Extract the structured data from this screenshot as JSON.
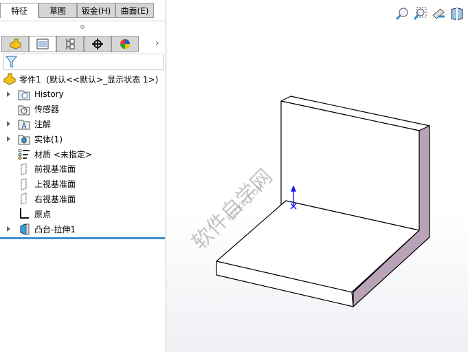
{
  "cmd_tabs": [
    "特征",
    "草图",
    "钣金(H)",
    "曲面(E)"
  ],
  "manager_tabs": [
    "featuremanager",
    "propertymanager",
    "configurationmanager",
    "dimxpert",
    "displaymanager"
  ],
  "root": "零件1  (默认<<默认>_显示状态 1>)",
  "tree": [
    {
      "label": "History",
      "expand": true,
      "icon": "history-folder-icon"
    },
    {
      "label": "传感器",
      "expand": false,
      "icon": "sensor-folder-icon"
    },
    {
      "label": "注解",
      "expand": true,
      "icon": "annotation-folder-icon"
    },
    {
      "label": "实体(1)",
      "expand": true,
      "icon": "solid-bodies-folder-icon"
    },
    {
      "label": "材质 <未指定>",
      "expand": false,
      "icon": "material-icon"
    },
    {
      "label": "前视基准面",
      "expand": false,
      "icon": "plane-icon"
    },
    {
      "label": "上视基准面",
      "expand": false,
      "icon": "plane-icon"
    },
    {
      "label": "右视基准面",
      "expand": false,
      "icon": "plane-icon"
    },
    {
      "label": "原点",
      "expand": false,
      "icon": "origin-icon"
    },
    {
      "label": "凸台-拉伸1",
      "expand": true,
      "icon": "extrude-icon"
    }
  ],
  "watermark": "软件自学网",
  "watermark_url": "RJZXW.COM",
  "colors": {
    "accent": "#3b8fd0",
    "side_face": "#b9a3b6"
  }
}
